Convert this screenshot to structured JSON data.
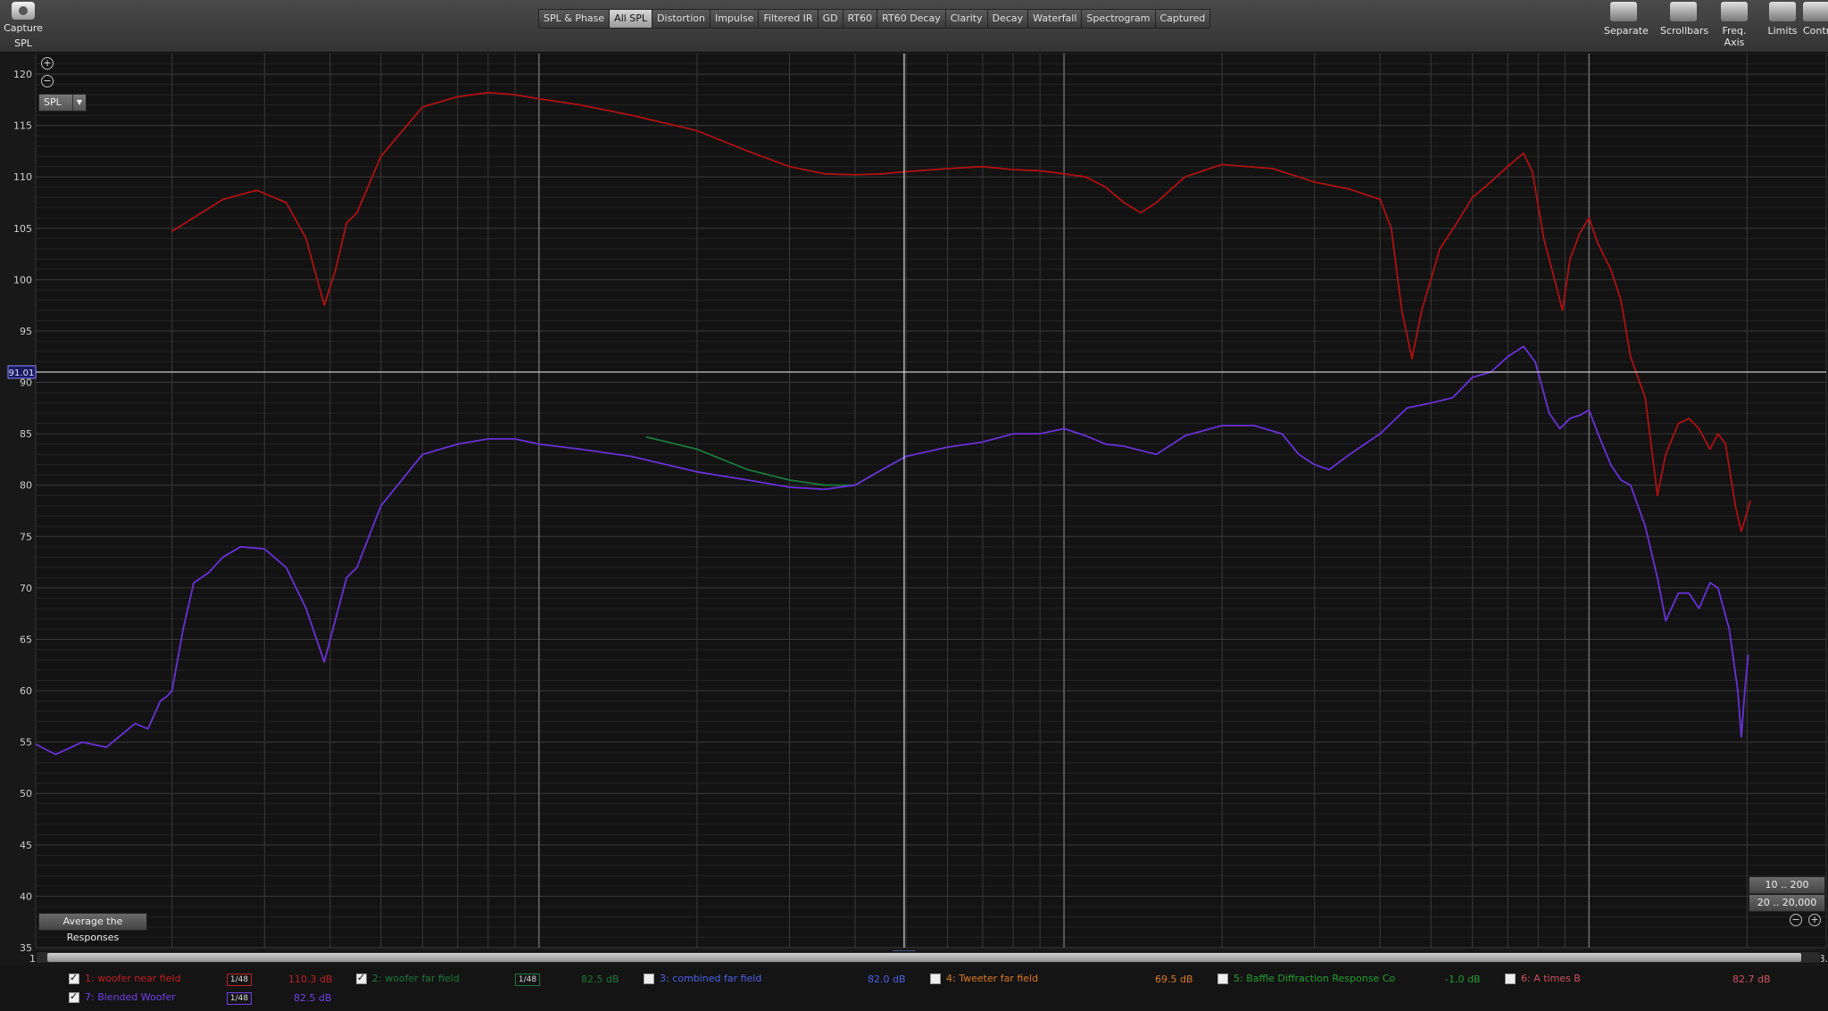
{
  "toolbar": {
    "capture_label": "Capture",
    "capture_sub": "SPL",
    "tabs": [
      "SPL & Phase",
      "All SPL",
      "Distortion",
      "Impulse",
      "Filtered IR",
      "GD",
      "RT60",
      "RT60 Decay",
      "Clarity",
      "Decay",
      "Waterfall",
      "Spectrogram",
      "Captured"
    ],
    "active_tab": "All SPL",
    "right_buttons": [
      "Separate",
      "Scrollbars",
      "Freq. Axis",
      "Limits",
      "Contr"
    ]
  },
  "graph": {
    "measure_select": "SPL",
    "cursor_level": "91.01",
    "cursor_freq": "496",
    "avg_button": "Average the Responses",
    "range_btn_1": "10 .. 200",
    "range_btn_2": "20 .. 20,000"
  },
  "chart_data": {
    "type": "line",
    "xscale": "log",
    "xlim": [
      11,
      28300
    ],
    "ylim": [
      35,
      122
    ],
    "yticks": [
      35,
      40,
      45,
      50,
      55,
      60,
      65,
      70,
      75,
      80,
      85,
      90,
      95,
      100,
      105,
      110,
      115,
      120
    ],
    "xticks": [
      {
        "v": 11,
        "l": "11"
      },
      {
        "v": 20,
        "l": "20"
      },
      {
        "v": 30,
        "l": "30"
      },
      {
        "v": 40,
        "l": "40"
      },
      {
        "v": 50,
        "l": "50"
      },
      {
        "v": 60,
        "l": "60"
      },
      {
        "v": 70,
        "l": "70"
      },
      {
        "v": 80,
        "l": "80"
      },
      {
        "v": 90,
        "l": "90"
      },
      {
        "v": 100,
        "l": "100"
      },
      {
        "v": 200,
        "l": "200"
      },
      {
        "v": 300,
        "l": "300"
      },
      {
        "v": 400,
        "l": "400"
      },
      {
        "v": 600,
        "l": "600"
      },
      {
        "v": 700,
        "l": "700"
      },
      {
        "v": 800,
        "l": "800"
      },
      {
        "v": 900,
        "l": "900"
      },
      {
        "v": 1000,
        "l": "1k"
      },
      {
        "v": 2000,
        "l": "2k"
      },
      {
        "v": 3000,
        "l": "3k"
      },
      {
        "v": 4000,
        "l": "4k"
      },
      {
        "v": 5000,
        "l": "5k"
      },
      {
        "v": 6000,
        "l": "6k"
      },
      {
        "v": 7000,
        "l": "7k"
      },
      {
        "v": 8000,
        "l": "8k"
      },
      {
        "v": 9000,
        "l": "9k"
      },
      {
        "v": 10000,
        "l": "10k"
      },
      {
        "v": 11000,
        "l": "11k"
      },
      {
        "v": 12000,
        "l": "12k"
      },
      {
        "v": 14000,
        "l": "14k"
      },
      {
        "v": 16000,
        "l": "16k"
      },
      {
        "v": 18000,
        "l": "18k"
      },
      {
        "v": 20000,
        "l": "20k"
      },
      {
        "v": 22000,
        "l": "22k"
      },
      {
        "v": 24000,
        "l": "24k"
      },
      {
        "v": 28300,
        "l": "28.3k"
      }
    ],
    "cursor": {
      "x": 496,
      "y": 91.01
    },
    "series": [
      {
        "name": "1: woofer near field",
        "color": "#b01010",
        "points": [
          [
            20,
            104.7
          ],
          [
            25,
            107.8
          ],
          [
            29,
            108.7
          ],
          [
            33,
            107.5
          ],
          [
            36,
            104
          ],
          [
            39,
            97.5
          ],
          [
            41,
            101
          ],
          [
            43,
            105.5
          ],
          [
            45,
            106.5
          ],
          [
            50,
            112
          ],
          [
            60,
            116.8
          ],
          [
            70,
            117.8
          ],
          [
            80,
            118.2
          ],
          [
            90,
            118
          ],
          [
            100,
            117.6
          ],
          [
            120,
            117
          ],
          [
            150,
            116
          ],
          [
            200,
            114.5
          ],
          [
            250,
            112.5
          ],
          [
            300,
            111
          ],
          [
            350,
            110.3
          ],
          [
            400,
            110.2
          ],
          [
            450,
            110.3
          ],
          [
            500,
            110.5
          ],
          [
            600,
            110.8
          ],
          [
            700,
            111
          ],
          [
            800,
            110.7
          ],
          [
            900,
            110.6
          ],
          [
            1000,
            110.3
          ],
          [
            1100,
            110
          ],
          [
            1200,
            109
          ],
          [
            1300,
            107.5
          ],
          [
            1400,
            106.5
          ],
          [
            1500,
            107.5
          ],
          [
            1700,
            110
          ],
          [
            2000,
            111.2
          ],
          [
            2500,
            110.8
          ],
          [
            3000,
            109.5
          ],
          [
            3500,
            108.8
          ],
          [
            4000,
            107.8
          ],
          [
            4200,
            105
          ],
          [
            4400,
            97
          ],
          [
            4600,
            92.3
          ],
          [
            4800,
            97
          ],
          [
            5200,
            103
          ],
          [
            5600,
            105.5
          ],
          [
            6000,
            108
          ],
          [
            6500,
            109.5
          ],
          [
            7000,
            111
          ],
          [
            7500,
            112.3
          ],
          [
            7800,
            110.5
          ],
          [
            8200,
            104
          ],
          [
            8600,
            100
          ],
          [
            8900,
            97
          ],
          [
            9200,
            102
          ],
          [
            9600,
            104.5
          ],
          [
            10000,
            106
          ],
          [
            10400,
            103.5
          ],
          [
            11000,
            101
          ],
          [
            11500,
            98
          ],
          [
            12000,
            92.5
          ],
          [
            12800,
            88.5
          ],
          [
            13500,
            79
          ],
          [
            14000,
            83
          ],
          [
            14800,
            86
          ],
          [
            15500,
            86.5
          ],
          [
            16200,
            85.5
          ],
          [
            17000,
            83.5
          ],
          [
            17600,
            85
          ],
          [
            18200,
            84
          ],
          [
            19000,
            78
          ],
          [
            19500,
            75.5
          ],
          [
            20300,
            78.5
          ]
        ]
      },
      {
        "name": "2: woofer far field",
        "color": "#1a7a3a",
        "points": [
          [
            160,
            84.7
          ],
          [
            200,
            83.5
          ],
          [
            250,
            81.5
          ],
          [
            300,
            80.5
          ],
          [
            350,
            80
          ],
          [
            400,
            80
          ],
          [
            450,
            81.5
          ],
          [
            500,
            82.8
          ]
        ]
      },
      {
        "name": "7: Blended Woofer",
        "color": "#6a30d8",
        "points": [
          [
            11,
            54.8
          ],
          [
            12,
            53.8
          ],
          [
            13.5,
            55
          ],
          [
            15,
            54.5
          ],
          [
            17,
            56.8
          ],
          [
            18,
            56.3
          ],
          [
            19,
            59
          ],
          [
            19.6,
            59.5
          ],
          [
            20,
            60
          ],
          [
            21,
            66
          ],
          [
            22,
            70.5
          ],
          [
            23.5,
            71.5
          ],
          [
            25,
            73
          ],
          [
            27,
            74
          ],
          [
            30,
            73.8
          ],
          [
            33,
            72
          ],
          [
            36,
            68
          ],
          [
            39,
            62.8
          ],
          [
            41,
            67
          ],
          [
            43,
            71
          ],
          [
            45,
            72
          ],
          [
            50,
            78
          ],
          [
            60,
            83
          ],
          [
            70,
            84
          ],
          [
            80,
            84.5
          ],
          [
            90,
            84.5
          ],
          [
            100,
            84
          ],
          [
            120,
            83.5
          ],
          [
            150,
            82.8
          ],
          [
            200,
            81.3
          ],
          [
            250,
            80.5
          ],
          [
            300,
            79.8
          ],
          [
            350,
            79.6
          ],
          [
            400,
            80
          ],
          [
            450,
            81.5
          ],
          [
            500,
            82.8
          ],
          [
            600,
            83.7
          ],
          [
            700,
            84.2
          ],
          [
            800,
            85
          ],
          [
            900,
            85
          ],
          [
            1000,
            85.5
          ],
          [
            1100,
            84.8
          ],
          [
            1200,
            84
          ],
          [
            1300,
            83.8
          ],
          [
            1500,
            83
          ],
          [
            1700,
            84.8
          ],
          [
            2000,
            85.8
          ],
          [
            2300,
            85.8
          ],
          [
            2600,
            85
          ],
          [
            2800,
            83
          ],
          [
            3000,
            82
          ],
          [
            3200,
            81.5
          ],
          [
            3500,
            83
          ],
          [
            4000,
            85
          ],
          [
            4500,
            87.5
          ],
          [
            5000,
            88
          ],
          [
            5500,
            88.5
          ],
          [
            6000,
            90.5
          ],
          [
            6500,
            91
          ],
          [
            7000,
            92.5
          ],
          [
            7500,
            93.5
          ],
          [
            7900,
            92
          ],
          [
            8400,
            87
          ],
          [
            8800,
            85.5
          ],
          [
            9200,
            86.5
          ],
          [
            9600,
            86.8
          ],
          [
            10000,
            87.3
          ],
          [
            10400,
            85
          ],
          [
            11000,
            82
          ],
          [
            11500,
            80.5
          ],
          [
            12000,
            80
          ],
          [
            12800,
            76
          ],
          [
            13500,
            71
          ],
          [
            14000,
            66.8
          ],
          [
            14800,
            69.5
          ],
          [
            15500,
            69.5
          ],
          [
            16200,
            68
          ],
          [
            17000,
            70.5
          ],
          [
            17600,
            70
          ],
          [
            18500,
            66
          ],
          [
            19200,
            60
          ],
          [
            19500,
            55.5
          ],
          [
            19800,
            60
          ],
          [
            20100,
            63.5
          ]
        ]
      }
    ]
  },
  "legend": [
    {
      "text": "1: woofer near field",
      "color": "#c02020",
      "checked": true,
      "smooth": "1/48",
      "value": "110.3 dB"
    },
    {
      "text": "2: woofer far field",
      "color": "#1a7a3a",
      "checked": true,
      "smooth": "1/48",
      "value": "82.5 dB"
    },
    {
      "text": "3: combined far field",
      "color": "#4a60e8",
      "checked": false,
      "value": "82.0 dB"
    },
    {
      "text": "4: Tweeter far field",
      "color": "#e07820",
      "checked": false,
      "value": "69.5 dB"
    },
    {
      "text": "5: Baffle Diffraction Response Co",
      "color": "#20a030",
      "checked": false,
      "value": "-1.0 dB"
    },
    {
      "text": "6: A times B",
      "color": "#d05060",
      "checked": false,
      "value": "82.7 dB"
    },
    {
      "text": "7: Blended Woofer",
      "color": "#7040e8",
      "checked": true,
      "smooth": "1/48",
      "value": "82.5 dB"
    }
  ]
}
